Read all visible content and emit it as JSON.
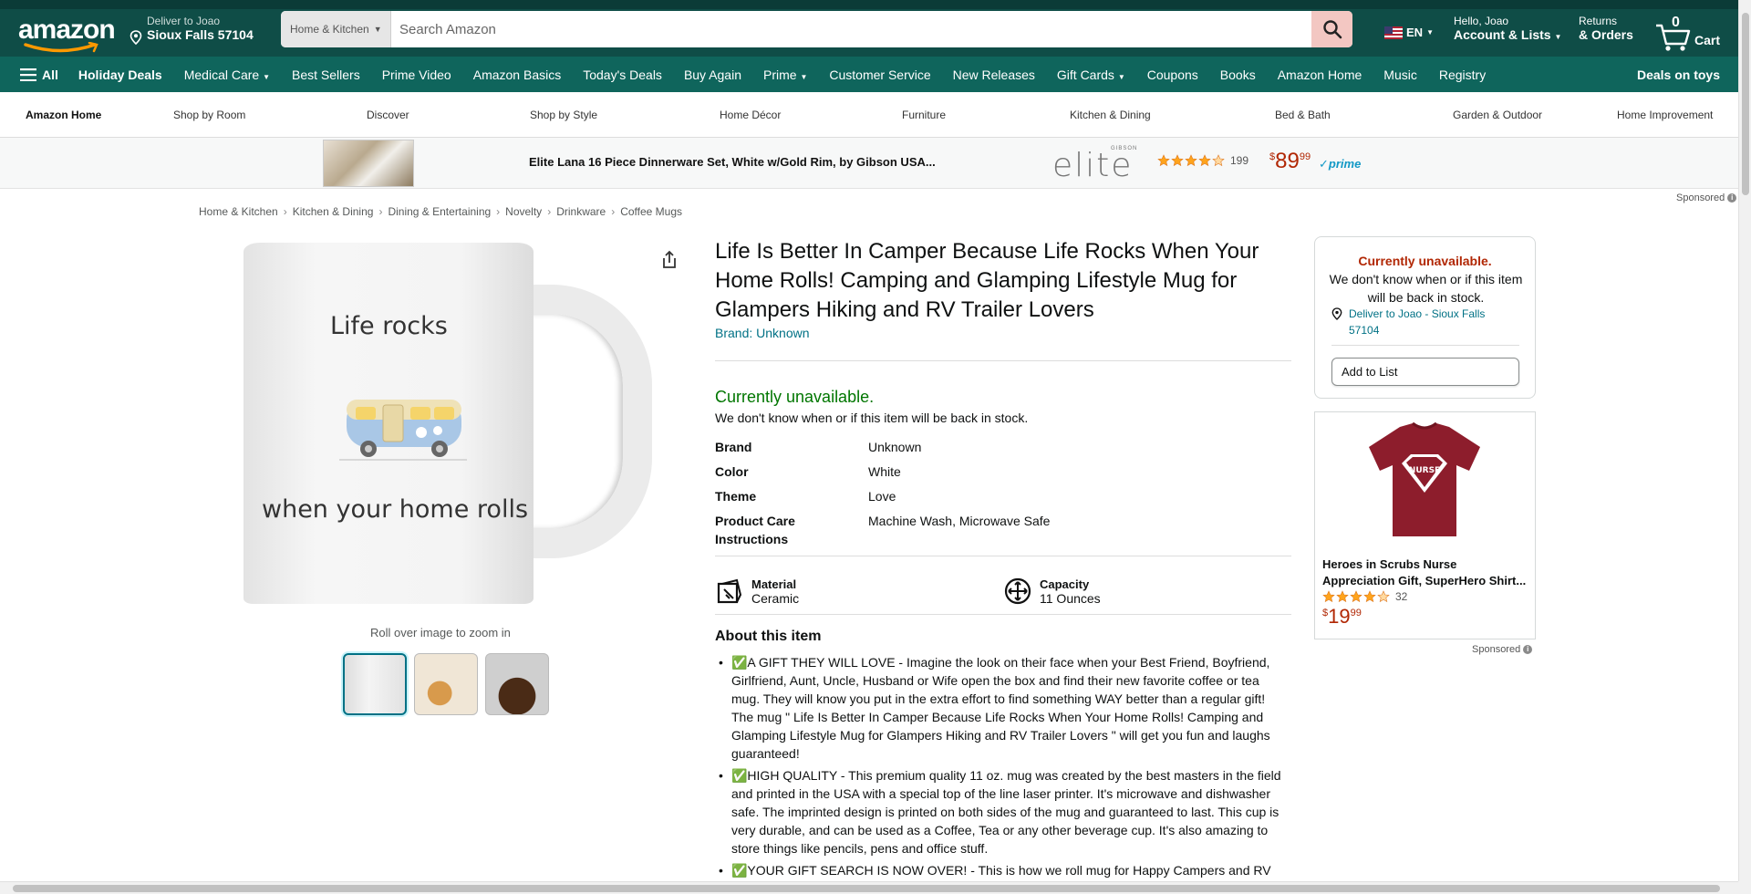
{
  "header": {
    "logo": "amazon",
    "deliver_line1": "Deliver to Joao",
    "deliver_line2": "Sioux Falls 57104",
    "search_category": "Home & Kitchen",
    "search_placeholder": "Search Amazon",
    "lang": "EN",
    "account_line1": "Hello, Joao",
    "account_line2": "Account & Lists",
    "returns_line1": "Returns",
    "returns_line2": "& Orders",
    "cart_count": "0",
    "cart_label": "Cart"
  },
  "nav": {
    "all": "All",
    "items": [
      "Holiday Deals",
      "Medical Care",
      "Best Sellers",
      "Prime Video",
      "Amazon Basics",
      "Today's Deals",
      "Buy Again",
      "Prime",
      "Customer Service",
      "New Releases",
      "Gift Cards",
      "Coupons",
      "Books",
      "Amazon Home",
      "Music",
      "Registry"
    ],
    "right": "Deals on toys"
  },
  "subnav": [
    "Amazon Home",
    "Shop by Room",
    "Discover",
    "Shop by Style",
    "Home Décor",
    "Furniture",
    "Kitchen & Dining",
    "Bed & Bath",
    "Garden & Outdoor",
    "Home Improvement"
  ],
  "promo": {
    "title": "Elite Lana 16 Piece Dinnerware Set, White w/Gold Rim, by Gibson USA...",
    "brand": "elite",
    "brand_sub": "GIBSON",
    "rating_count": "199",
    "price_whole": "89",
    "price_fraction": "99",
    "currency": "$",
    "prime": "prime",
    "sponsored": "Sponsored"
  },
  "breadcrumbs": [
    "Home & Kitchen",
    "Kitchen & Dining",
    "Dining & Entertaining",
    "Novelty",
    "Drinkware",
    "Coffee Mugs"
  ],
  "image": {
    "mug_text_top": "Life rocks",
    "mug_text_bottom": "when your home rolls",
    "zoom_hint": "Roll over image to zoom in"
  },
  "product": {
    "title": "Life Is Better In Camper Because Life Rocks When Your Home Rolls! Camping and Glamping Lifestyle Mug for Glampers Hiking and RV Trailer Lovers",
    "brand_link": "Brand: Unknown",
    "availability": "Currently unavailable.",
    "availability_sub": "We don't know when or if this item will be back in stock.",
    "attributes": [
      {
        "k": "Brand",
        "v": "Unknown"
      },
      {
        "k": "Color",
        "v": "White"
      },
      {
        "k": "Theme",
        "v": "Love"
      },
      {
        "k": "Product Care Instructions",
        "v": "Machine Wash, Microwave Safe"
      }
    ],
    "features": [
      {
        "k": "Material",
        "v": "Ceramic"
      },
      {
        "k": "Capacity",
        "v": "11 Ounces"
      }
    ],
    "about_title": "About this item",
    "bullets": [
      "✅A GIFT THEY WILL LOVE - Imagine the look on their face when your Best Friend, Boyfriend, Girlfriend, Aunt, Uncle, Husband or Wife open the box and find their new favorite coffee or tea mug. They will know you put in the extra effort to find something WAY better than a regular gift! The mug \" Life Is Better In Camper Because Life Rocks When Your Home Rolls! Camping and Glamping Lifestyle Mug for Glampers Hiking and RV Trailer Lovers \" will get you fun and laughs guaranteed!",
      "✅HIGH QUALITY - This premium quality 11 oz. mug was created by the best masters in the field and printed in the USA with a special top of the line laser printer. It's microwave and dishwasher safe. The imprinted design is printed on both sides of the mug and guaranteed to last. This cup is very durable, and can be used as a Coffee, Tea or any other beverage cup. It's also amazing to store things like pencils, pens and office stuff.",
      "✅YOUR GIFT SEARCH IS NOW OVER! - This is how we roll mug for Happy Campers and RV"
    ]
  },
  "buybox": {
    "unavailable": "Currently unavailable.",
    "sub": "We don't know when or if this item will be back in stock.",
    "deliver": "Deliver to Joao - Sioux Falls 57104",
    "add_to_list": "Add to List"
  },
  "ad": {
    "title": "Heroes in Scrubs Nurse Appreciation Gift, SuperHero Shirt...",
    "rating_count": "32",
    "price_whole": "19",
    "price_fraction": "99",
    "currency": "$",
    "shirt_text": "NURSE",
    "sponsored": "Sponsored"
  },
  "colors": {
    "nav_dark": "#0f4d47",
    "nav_mid": "#0f655c",
    "link": "#007185",
    "price": "#b12704",
    "in_stock": "#007600"
  }
}
